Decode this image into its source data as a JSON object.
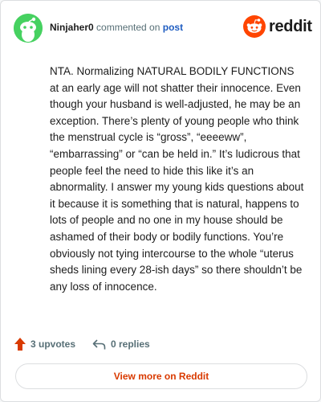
{
  "header": {
    "username": "Ninjaher0",
    "action_text": "commented on",
    "post_link": "post",
    "logo_text": "reddit",
    "avatar_icon": "snoo-avatar-icon",
    "logo_icon": "reddit-alien-icon"
  },
  "comment": {
    "body": "NTA. Normalizing NATURAL BODILY FUNCTIONS at an early age will not shatter their innocence. Even though your husband is well-adjusted, he may be an exception. There’s plenty of young people who think the menstrual cycle is “gross”, “eeeeww”, “embarrassing” or “can be held in.” It’s ludicrous that people feel the need to hide this like it’s an abnormality. I answer my young kids questions about it because it is something that is natural, happens to lots of people and no one in my house should be ashamed of their body or bodily functions. You’re obviously not tying intercourse to the whole “uterus sheds lining every 28-ish days” so there shouldn’t be any loss of innocence."
  },
  "actions": {
    "upvotes": "3 upvotes",
    "replies": "0 replies",
    "upvote_icon": "upvote-arrow-icon",
    "reply_icon": "reply-arrow-icon"
  },
  "footer": {
    "view_more": "View more on Reddit"
  },
  "colors": {
    "accent": "#d93a00",
    "reddit_orange": "#ff4500",
    "avatar_green": "#46d160",
    "link_blue": "#1f5dc1",
    "muted_text": "#576f76"
  }
}
